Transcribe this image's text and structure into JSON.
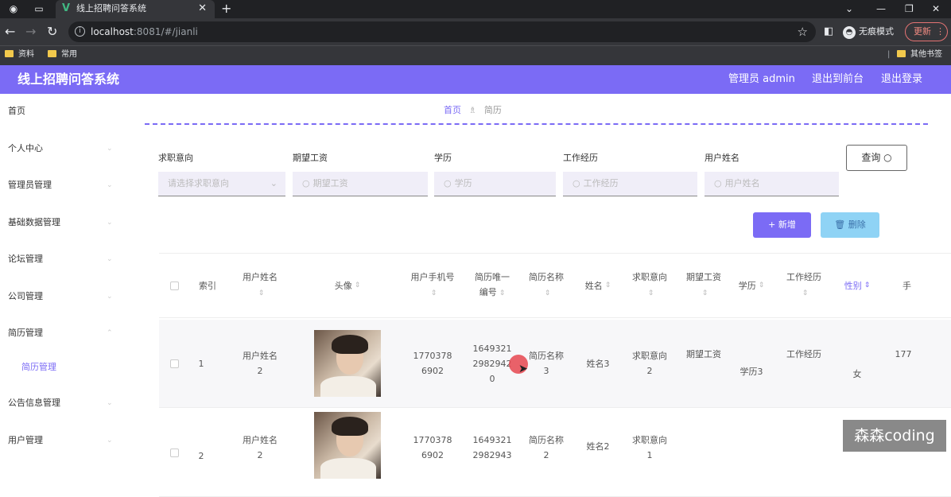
{
  "browser": {
    "tab_title": "线上招聘问答系统",
    "url_host": "localhost",
    "url_rest": ":8081/#/jianli",
    "incognito_label": "无痕模式",
    "update_label": "更新",
    "bookmarks": [
      "资料",
      "常用"
    ],
    "other_bookmarks": "其他书签"
  },
  "app": {
    "title": "线上招聘问答系统",
    "admin_label": "管理员 admin",
    "back_front": "退出到前台",
    "logout": "退出登录"
  },
  "sidebar": {
    "items": [
      "首页",
      "个人中心",
      "管理员管理",
      "基础数据管理",
      "论坛管理",
      "公司管理",
      "简历管理",
      "公告信息管理",
      "用户管理"
    ],
    "subitem": "简历管理"
  },
  "breadcrumb": {
    "home": "首页",
    "current": "简历"
  },
  "filters": {
    "labels": [
      "求职意向",
      "期望工资",
      "学历",
      "工作经历",
      "用户姓名"
    ],
    "placeholders": [
      "请选择求职意向",
      "期望工资",
      "学历",
      "工作经历",
      "用户姓名"
    ],
    "query_label": "查询"
  },
  "actions": {
    "add": "新增",
    "delete": "删除"
  },
  "table": {
    "headers": [
      "索引",
      "用户姓名",
      "头像",
      "用户手机号",
      "简历唯一编号",
      "简历名称",
      "姓名",
      "求职意向",
      "期望工资",
      "学历",
      "工作经历",
      "性别",
      "手"
    ],
    "rows": [
      {
        "index": "1",
        "user": "用户姓名2",
        "phone": "17703786902",
        "code": "16493212982942 0",
        "resume": "简历名称3",
        "name": "姓名3",
        "intent": "求职意向2",
        "salary": "期望工资",
        "edu": "学历3",
        "exp": "工作经历",
        "gender": "女",
        "extra": "177"
      },
      {
        "index": "2",
        "user": "用户姓名2",
        "phone": "17703786902",
        "code": "16493212982943",
        "resume": "简历名称2",
        "name": "姓名2",
        "intent": "求职意向1",
        "salary": "",
        "edu": "",
        "exp": "",
        "gender": "",
        "extra": ""
      }
    ]
  },
  "watermark": "森森coding"
}
